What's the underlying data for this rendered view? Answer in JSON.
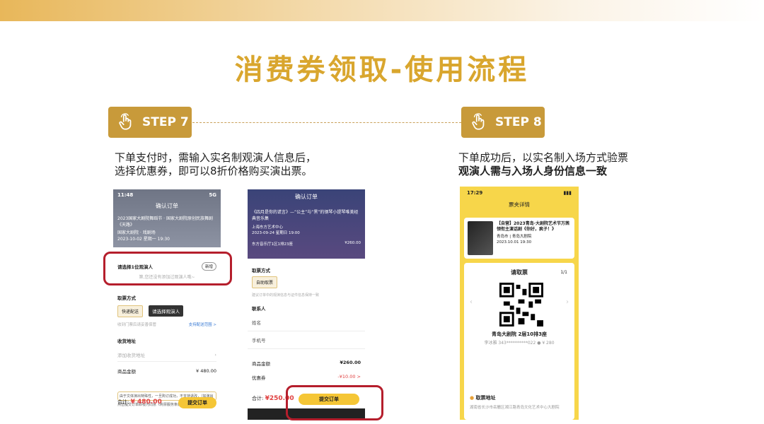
{
  "title": "消费券领取-使用流程",
  "step7": {
    "label": "STEP 7",
    "line1": "下单支付时，需输入实名制观演人信息后，",
    "line2": "选择优惠券，即可以8折价格购买演出票。"
  },
  "step8": {
    "label": "STEP 8",
    "line1": "下单成功后，以实名制入场方式验票",
    "line2": "观演人需与入场人身份信息一致"
  },
  "phone1": {
    "time": "11:48",
    "signal": "5G",
    "nav_title": "确认订单",
    "show_name": "2023国家大剧院舞蹈节 · 国家大剧院原创民族舞剧《天路》",
    "venue": "国家大剧院 · 戏剧场",
    "date": "2023-10-02 星期一 19:30",
    "viewer_label": "请选择1位观演人",
    "add_label": "新增",
    "viewer_empty": "第,您还没有添加过观演人哦~",
    "delivery_label": "取票方式",
    "delivery_option": "快递配送",
    "tooltip": "请选择观演人",
    "delivery_note": "收到门票后请妥善保管",
    "delivery_link": "支持配送范围 >",
    "address_label": "收货地址",
    "address_placeholder": "添加收货地址",
    "goods_label": "商品金额",
    "goods_value": "¥ 480.00",
    "agree_text": "由于文体演出特殊性，一旦购订成功，不支持退改，（如演出",
    "agree_text2": "点击提交订单即视为同意《购票服务条款》",
    "total_label": "合计:",
    "total_value": "¥ 480.00",
    "submit": "提交订单"
  },
  "phone2": {
    "nav_title": "确认订单",
    "show_name": "《四月是你的谎言》—“公主”与“黑”的钢琴小提琴唯美经典音乐集",
    "venue": "上海东方艺术中心",
    "date": "2023-09-24 星期日 19:00",
    "seat": "东方音乐厅1区1排23座",
    "price": "¥260.00",
    "delivery_label": "取票方式",
    "delivery_option": "自助取票",
    "delivery_note": "建议订单中的观演信息与证件信息保持一致",
    "contact_label": "联系人",
    "name_label": "姓名",
    "phone_label": "手机号",
    "goods_label": "商品金额",
    "goods_value": "¥260.00",
    "discount_label": "优惠券",
    "discount_value": "-¥10.00 >",
    "total_label": "合计:",
    "total_value": "¥250.00",
    "submit": "提交订单"
  },
  "phone3": {
    "time": "17:29",
    "nav_title": "票夹详情",
    "show_name": "【自营】2023青岛·大剧院艺术节万茜领衔主演话剧《你好，疯子！》",
    "venue": "青岛市 | 青岛大剧院",
    "date": "2023.10.01 19:30",
    "ticket_title": "请取票",
    "page": "1/1",
    "seat": "青岛大剧院 2层10排3座",
    "holder": "李冰雅 343**********022 ● ¥ 280",
    "address_label": "取票地址",
    "address_value": "湖南省长沙市岳麓区湘江路青岛文化艺术中心大剧院"
  }
}
